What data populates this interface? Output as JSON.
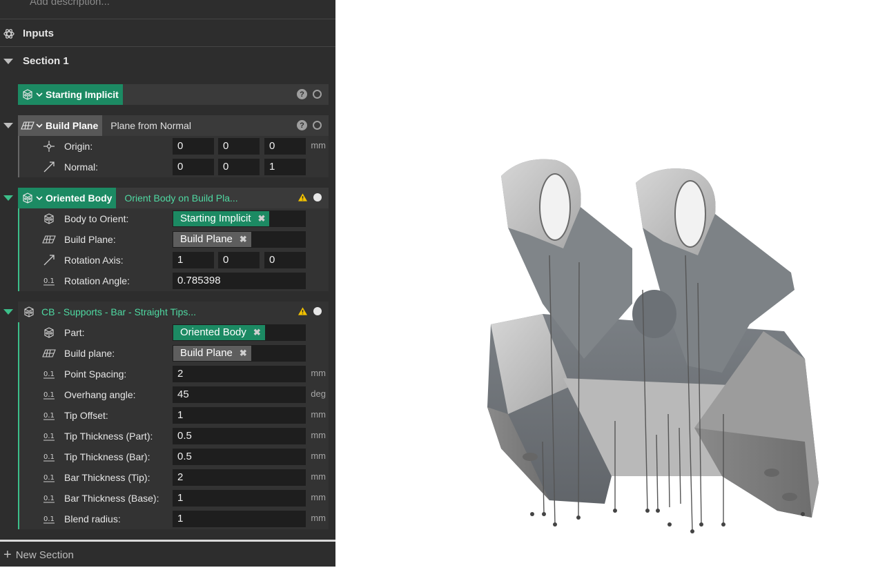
{
  "panel": {
    "description_placeholder": "Add description...",
    "inputs_label": "Inputs",
    "section_title": "Section 1",
    "new_section_label": "New Section"
  },
  "blocks": {
    "starting_implicit": {
      "title": "Starting Implicit"
    },
    "build_plane": {
      "title": "Build Plane",
      "subtitle": "Plane from Normal",
      "origin": {
        "label": "Origin:",
        "values": [
          "0",
          "0",
          "0"
        ],
        "unit": "mm"
      },
      "normal": {
        "label": "Normal:",
        "values": [
          "0",
          "0",
          "1"
        ]
      }
    },
    "oriented_body": {
      "title": "Oriented Body",
      "subtitle": "Orient Body on Build Pla...",
      "body_to_orient": {
        "label": "Body to Orient:",
        "value": "Starting Implicit"
      },
      "build_plane": {
        "label": "Build Plane:",
        "value": "Build Plane"
      },
      "rotation_axis": {
        "label": "Rotation Axis:",
        "values": [
          "1",
          "0",
          "0"
        ]
      },
      "rotation_angle": {
        "label": "Rotation Angle:",
        "value": "0.785398"
      }
    },
    "supports": {
      "title": "CB - Supports - Bar - Straight Tips...",
      "part": {
        "label": "Part:",
        "value": "Oriented Body"
      },
      "build_plane": {
        "label": "Build plane:",
        "value": "Build Plane"
      },
      "point_spacing": {
        "label": "Point Spacing:",
        "value": "2",
        "unit": "mm"
      },
      "overhang_angle": {
        "label": "Overhang angle:",
        "value": "45",
        "unit": "deg"
      },
      "tip_offset": {
        "label": "Tip Offset:",
        "value": "1",
        "unit": "mm"
      },
      "tip_thickness_part": {
        "label": "Tip Thickness (Part):",
        "value": "0.5",
        "unit": "mm"
      },
      "tip_thickness_bar": {
        "label": "Tip Thickness (Bar):",
        "value": "0.5",
        "unit": "mm"
      },
      "bar_thickness_tip": {
        "label": "Bar Thickness (Tip):",
        "value": "2",
        "unit": "mm"
      },
      "bar_thickness_base": {
        "label": "Bar Thickness (Base):",
        "value": "1",
        "unit": "mm"
      },
      "blend_radius": {
        "label": "Blend radius:",
        "value": "1",
        "unit": "mm"
      }
    }
  },
  "icons": {
    "help": "?",
    "remove": "✖",
    "add": "+"
  },
  "colors": {
    "accent_green": "#1c8a63",
    "accent_green_text": "#4fd9a2",
    "panel_bg": "#2d2d2d",
    "warning": "#f2c200"
  }
}
